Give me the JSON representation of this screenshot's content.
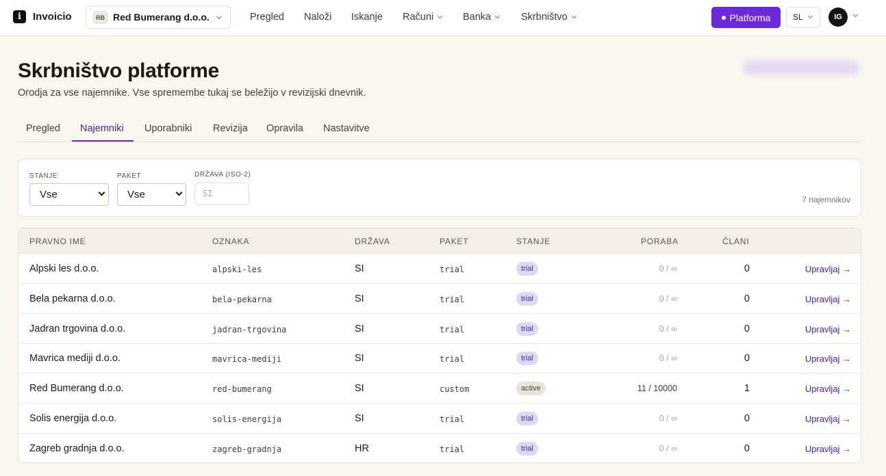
{
  "app": {
    "logo_letter": "i",
    "name": "Invoicio"
  },
  "org_switcher": {
    "badge": "RB",
    "name": "Red Bumerang d.o.o."
  },
  "nav": [
    {
      "label": "Pregled"
    },
    {
      "label": "Naloži"
    },
    {
      "label": "Iskanje"
    },
    {
      "label": "Računi"
    },
    {
      "label": "Banka"
    },
    {
      "label": "Skrbništvo"
    }
  ],
  "platform_button": "Platforma",
  "language": "SL",
  "user_initials": "IG",
  "header": {
    "title": "Skrbništvo platforme",
    "subtitle": "Orodja za vse najemnike. Vse spremembe tukaj se beležijo v revizijski dnevnik."
  },
  "tabs": [
    {
      "label": "Pregled"
    },
    {
      "label": "Najemniki",
      "active": true
    },
    {
      "label": "Uporabniki"
    },
    {
      "label": "Revizija"
    },
    {
      "label": "Opravila"
    },
    {
      "label": "Nastavitve"
    }
  ],
  "filters": {
    "state": {
      "label": "STANJE",
      "value": "Vse"
    },
    "plan": {
      "label": "PAKET",
      "value": "Vse"
    },
    "country": {
      "label": "DRŽAVA (ISO-2)",
      "placeholder": "SI"
    },
    "count": "7 najemnikov"
  },
  "table": {
    "columns": [
      "PRAVNO IME",
      "OZNAKA",
      "DRŽAVA",
      "PAKET",
      "STANJE",
      "PORABA",
      "ČLANI"
    ],
    "rows": [
      {
        "name": "Alpski les d.o.o.",
        "slug": "alpski-les",
        "country": "SI",
        "plan": "trial",
        "state": "trial",
        "usage": "0 / ∞",
        "members": "0",
        "action": "Upravljaj →"
      },
      {
        "name": "Bela pekarna d.o.o.",
        "slug": "bela-pekarna",
        "country": "SI",
        "plan": "trial",
        "state": "trial",
        "usage": "0 / ∞",
        "members": "0",
        "action": "Upravljaj →"
      },
      {
        "name": "Jadran trgovina d.o.o.",
        "slug": "jadran-trgovina",
        "country": "SI",
        "plan": "trial",
        "state": "trial",
        "usage": "0 / ∞",
        "members": "0",
        "action": "Upravljaj →"
      },
      {
        "name": "Mavrica mediji d.o.o.",
        "slug": "mavrica-mediji",
        "country": "SI",
        "plan": "trial",
        "state": "trial",
        "usage": "0 / ∞",
        "members": "0",
        "action": "Upravljaj →"
      },
      {
        "name": "Red Bumerang d.o.o.",
        "slug": "red-bumerang",
        "country": "SI",
        "plan": "custom",
        "state": "active",
        "usage": "11 / 10000",
        "members": "1",
        "action": "Upravljaj →"
      },
      {
        "name": "Solis energija d.o.o.",
        "slug": "solis-energija",
        "country": "SI",
        "plan": "trial",
        "state": "trial",
        "usage": "0 / ∞",
        "members": "0",
        "action": "Upravljaj →"
      },
      {
        "name": "Zagreb gradnja d.o.o.",
        "slug": "zagreb-gradnja",
        "country": "HR",
        "plan": "trial",
        "state": "trial",
        "usage": "0 / ∞",
        "members": "0",
        "action": "Upravljaj →"
      }
    ]
  },
  "colors": {
    "accent": "#6d28d9",
    "background": "#f9f6f0",
    "trial_badge": "#ddd8f3",
    "active_badge": "#e7e4dc"
  }
}
